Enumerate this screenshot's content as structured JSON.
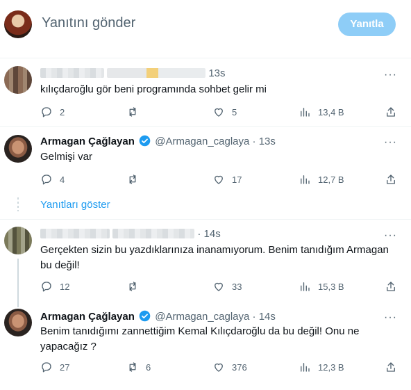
{
  "composer": {
    "placeholder": "Yanıtını gönder",
    "reply_button": "Yanıtla"
  },
  "tweets": [
    {
      "author_name": "",
      "author_handle": "",
      "time": "13s",
      "text": "kılıçdaroğlu gör beni programında sohbet gelir mi",
      "replies": "2",
      "retweets": "",
      "likes": "5",
      "views": "13,4 B"
    },
    {
      "author_name": "Armagan Çağlayan",
      "author_handle": "@Armagan_caglaya",
      "time": "13s",
      "text": "Gelmişi var",
      "replies": "4",
      "retweets": "",
      "likes": "17",
      "views": "12,7 B"
    },
    {
      "author_name": "",
      "author_handle": "",
      "time": "14s",
      "text": "Gerçekten sizin bu yazdıklarınıza inanamıyorum. Benim tanıdığım Armagan bu değil!",
      "replies": "12",
      "retweets": "",
      "likes": "33",
      "views": "15,3 B"
    },
    {
      "author_name": "Armagan Çağlayan",
      "author_handle": "@Armagan_caglaya",
      "time": "14s",
      "text": "Benim tanıdığımı zannettiğim Kemal Kılıçdaroğlu da bu değil! Onu ne yapacağız ?",
      "replies": "27",
      "retweets": "6",
      "likes": "376",
      "views": "12,3 B"
    }
  ],
  "thread": {
    "show_replies": "Yanıtları göster",
    "separator": "·"
  },
  "colors": {
    "accent": "#1d9bf0",
    "button_disabled": "#8ecdf7",
    "muted_text": "#536471",
    "divider": "#eff3f4"
  },
  "icons": [
    "reply-icon",
    "retweet-icon",
    "like-icon",
    "views-icon",
    "share-icon",
    "more-icon",
    "verified-icon"
  ]
}
